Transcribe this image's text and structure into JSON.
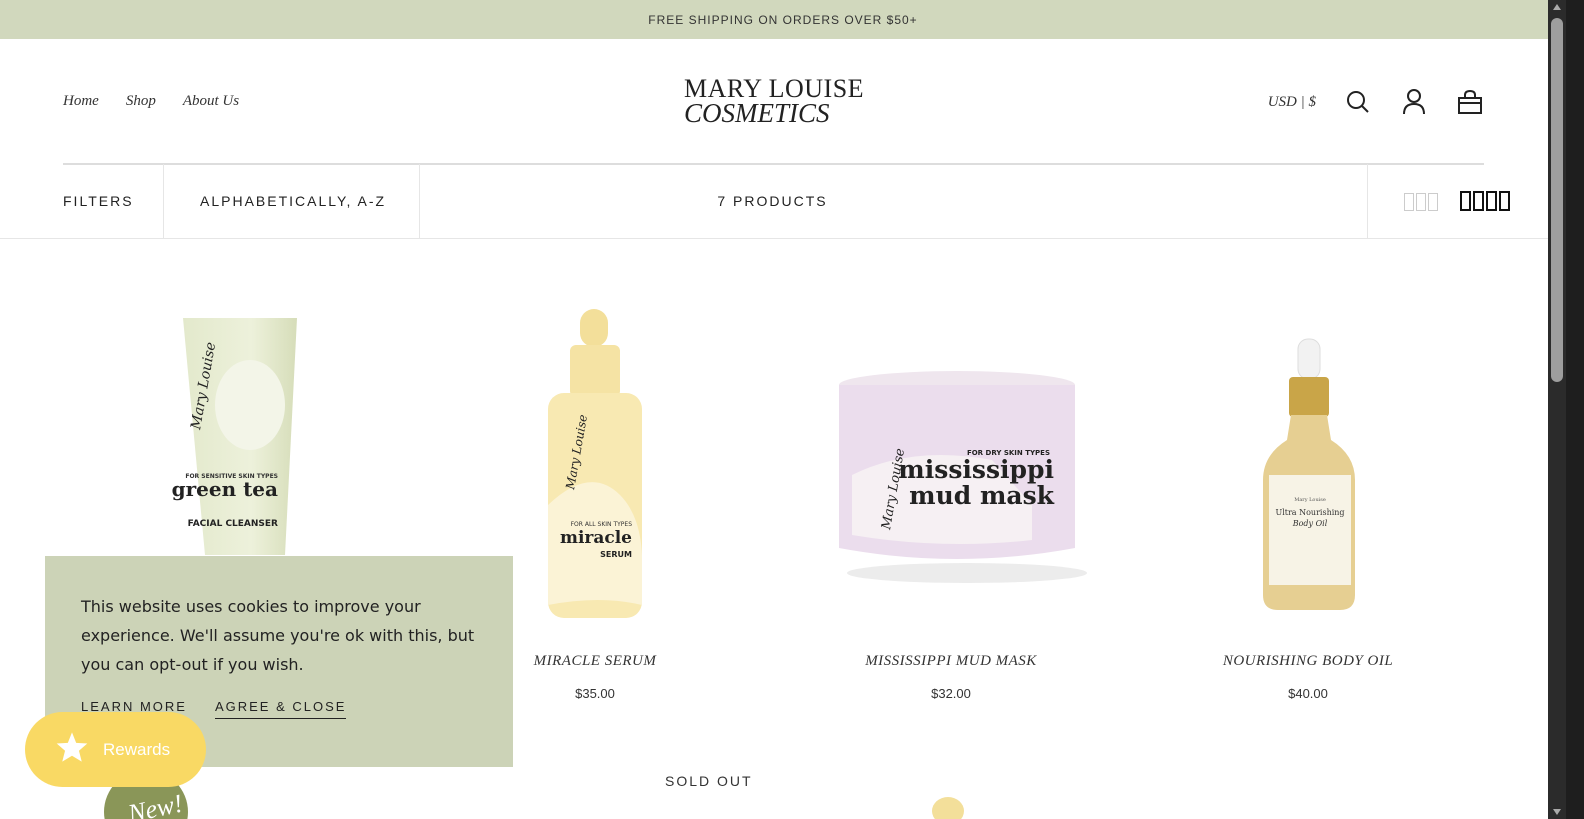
{
  "announcement": "FREE SHIPPING ON ORDERS OVER $50+",
  "nav": {
    "home": "Home",
    "shop": "Shop",
    "about": "About Us"
  },
  "logo": {
    "line1": "MARY LOUISE",
    "line2": "COSMETICS"
  },
  "header": {
    "currency": "USD | $",
    "icons": [
      "search-icon",
      "account-icon",
      "cart-icon"
    ]
  },
  "toolbar": {
    "filters": "FILTERS",
    "sort": "ALPHABETICALLY, A-Z",
    "count": "7 PRODUCTS",
    "view_options": [
      "grid-3-icon",
      "grid-4-icon"
    ]
  },
  "products": [
    {
      "title": "GREEN TEA FACIAL CLEANSER",
      "price": "",
      "label": "green tea",
      "sub": "FACIAL CLEANSER",
      "tag": "FOR SENSITIVE SKIN TYPES"
    },
    {
      "title": "MIRACLE SERUM",
      "price": "$35.00",
      "label": "miracle",
      "sub": "SERUM",
      "tag": "FOR ALL SKIN TYPES"
    },
    {
      "title": "MISSISSIPPI MUD MASK",
      "price": "$32.00",
      "label1": "mississippi",
      "label2": "mud mask",
      "tag": "FOR DRY SKIN TYPES"
    },
    {
      "title": "NOURISHING BODY OIL",
      "price": "$40.00",
      "label1": "Ultra Nourishing",
      "label2": "Body Oil"
    }
  ],
  "brand_script": "Mary Louise",
  "second_row": {
    "sold_out": "SOLD OUT",
    "badge": "New!"
  },
  "cookie": {
    "message": "This website uses cookies to improve your experience. We'll assume you're ok with this, but you can opt-out if you wish.",
    "learn_more": "LEARN MORE",
    "agree": "AGREE & CLOSE"
  },
  "rewards": {
    "label": "Rewards"
  },
  "colors": {
    "announcement_bg": "#d1d8bd",
    "cookie_bg": "#ccd3b7",
    "rewards_bg": "#f9d964",
    "badge_bg": "#8a9658"
  }
}
